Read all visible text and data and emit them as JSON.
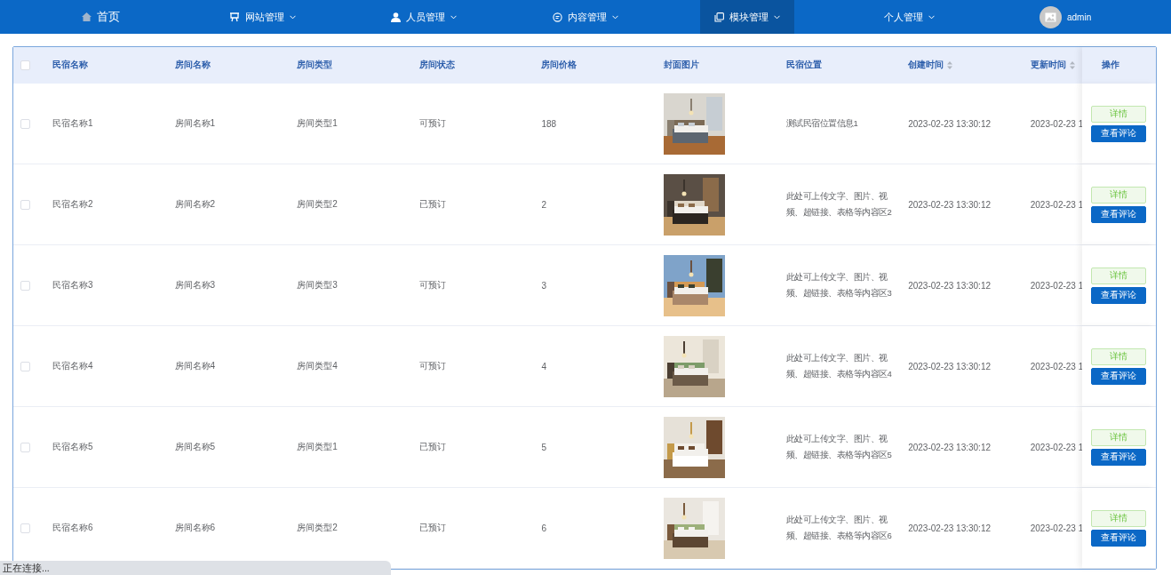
{
  "nav": {
    "items": [
      {
        "label": "首页",
        "dropdown": false,
        "selected": false
      },
      {
        "label": "网站管理",
        "dropdown": true,
        "selected": false
      },
      {
        "label": "人员管理",
        "dropdown": true,
        "selected": false
      },
      {
        "label": "内容管理",
        "dropdown": true,
        "selected": false
      },
      {
        "label": "模块管理",
        "dropdown": true,
        "selected": true
      },
      {
        "label": "个人管理",
        "dropdown": true,
        "selected": false
      }
    ],
    "user": {
      "name": "admin"
    }
  },
  "table": {
    "select_all": {
      "checked": false
    },
    "columns": [
      {
        "label": "民宿名称",
        "sortable": false
      },
      {
        "label": "房间名称",
        "sortable": false
      },
      {
        "label": "房间类型",
        "sortable": false
      },
      {
        "label": "房间状态",
        "sortable": false
      },
      {
        "label": "房间价格",
        "sortable": false
      },
      {
        "label": "封面图片",
        "sortable": false
      },
      {
        "label": "民宿位置",
        "sortable": false
      },
      {
        "label": "创建时间",
        "sortable": true
      },
      {
        "label": "更新时间",
        "sortable": true
      },
      {
        "label": "操作",
        "sortable": false
      }
    ],
    "rows": [
      {
        "checked": false,
        "cells": [
          "民宿名称1",
          "房间名称1",
          "房间类型1",
          "可预订",
          "188"
        ],
        "image": {
          "kind": "picture"
        },
        "location": "测试民宿位置信息1",
        "created": "2023-02-23 13:30:12",
        "updated": "2023-02-23 1",
        "actions": [
          "详情",
          "查看评论"
        ]
      },
      {
        "checked": false,
        "cells": [
          "民宿名称2",
          "房间名称2",
          "房间类型2",
          "已预订",
          "2"
        ],
        "image": {
          "kind": "picture"
        },
        "location": "此处可上传文字、图片、视频、超链接、表格等内容区2",
        "created": "2023-02-23 13:30:12",
        "updated": "2023-02-23 1",
        "actions": [
          "详情",
          "查看评论"
        ]
      },
      {
        "checked": false,
        "cells": [
          "民宿名称3",
          "房间名称3",
          "房间类型3",
          "可预订",
          "3"
        ],
        "image": {
          "kind": "picture"
        },
        "location": "此处可上传文字、图片、视频、超链接、表格等内容区3",
        "created": "2023-02-23 13:30:12",
        "updated": "2023-02-23 1",
        "actions": [
          "详情",
          "查看评论"
        ]
      },
      {
        "checked": false,
        "cells": [
          "民宿名称4",
          "房间名称4",
          "房间类型4",
          "可预订",
          "4"
        ],
        "image": {
          "kind": "picture"
        },
        "location": "此处可上传文字、图片、视频、超链接、表格等内容区4",
        "created": "2023-02-23 13:30:12",
        "updated": "2023-02-23 1",
        "actions": [
          "详情",
          "查看评论"
        ]
      },
      {
        "checked": false,
        "cells": [
          "民宿名称5",
          "房间名称5",
          "房间类型1",
          "已预订",
          "5"
        ],
        "image": {
          "kind": "picture"
        },
        "location": "此处可上传文字、图片、视频、超链接、表格等内容区5",
        "created": "2023-02-23 13:30:12",
        "updated": "2023-02-23 1",
        "actions": [
          "详情",
          "查看评论"
        ]
      },
      {
        "checked": false,
        "cells": [
          "民宿名称6",
          "房间名称6",
          "房间类型2",
          "已预订",
          "6"
        ],
        "image": {
          "kind": "picture"
        },
        "location": "此处可上传文字、图片、视频、超链接、表格等内容区6",
        "created": "2023-02-23 13:30:12",
        "updated": "2023-02-23 1",
        "actions": [
          "详情",
          "查看评论"
        ]
      }
    ]
  },
  "status_bar": {
    "text": "正在连接..."
  }
}
